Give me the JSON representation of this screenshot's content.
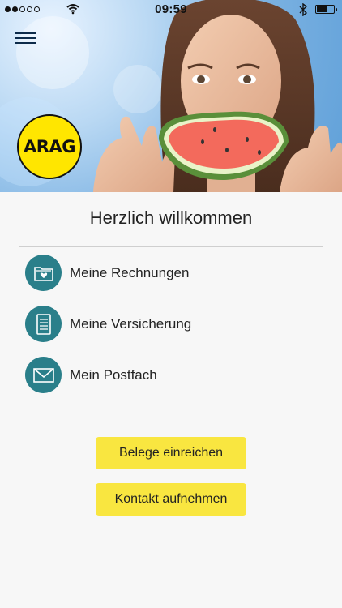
{
  "status_bar": {
    "signal_filled": 2,
    "signal_total": 5,
    "time": "09:59",
    "battery_level": 0.65
  },
  "header": {
    "menu_icon": "hamburger-menu-icon",
    "logo_text": "ARAG"
  },
  "main": {
    "welcome_title": "Herzlich willkommen",
    "menu_items": [
      {
        "label": "Meine Rechnungen",
        "icon": "folder-heart-icon"
      },
      {
        "label": "Meine Versicherung",
        "icon": "document-icon"
      },
      {
        "label": "Mein Postfach",
        "icon": "envelope-icon"
      }
    ],
    "actions": {
      "submit_receipts_label": "Belege einreichen",
      "contact_label": "Kontakt aufnehmen"
    }
  },
  "colors": {
    "accent_yellow": "#f9e640",
    "icon_teal": "#2a7f8a",
    "logo_yellow": "#ffe600"
  }
}
